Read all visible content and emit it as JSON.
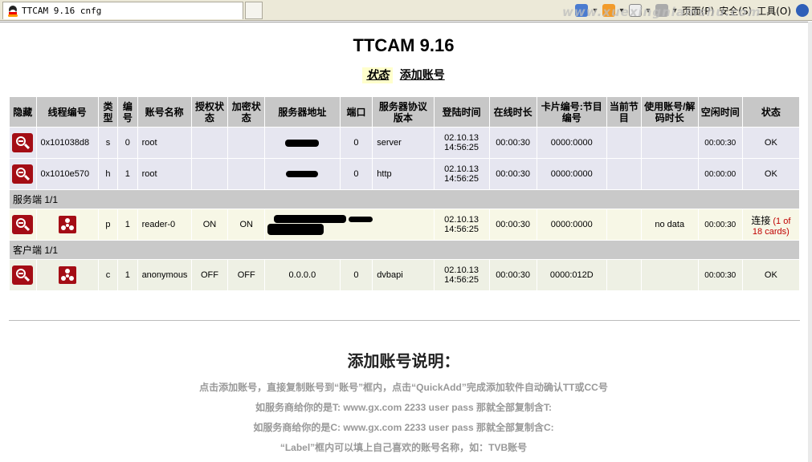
{
  "browser": {
    "tab_title": "TTCAM 9.16 cnfg",
    "menu_page": "页面(P)",
    "menu_safety": "安全(S)",
    "menu_tools": "工具(O)",
    "arrow": "▾",
    "watermark": "www.xuexingniamshu.com"
  },
  "page": {
    "title": "TTCAM 9.16",
    "nav_status": "状态",
    "nav_add": "添加账号"
  },
  "table": {
    "headers": [
      "隐藏",
      "线程编号",
      "类型",
      "编号",
      "账号名称",
      "授权状态",
      "加密状态",
      "服务器地址",
      "端口",
      "服务器协议版本",
      "登陆时间",
      "在线时长",
      "卡片编号:节目编号",
      "当前节目",
      "使用账号/解码时长",
      "空闲时间",
      "状态"
    ],
    "rows": [
      {
        "thread": "0x101038d8",
        "type": "s",
        "num": "0",
        "name": "root",
        "auth": "",
        "crypt": "",
        "port": "0",
        "proto": "server",
        "login_date": "02.10.13",
        "login_time": "14:56:25",
        "online": "00:00:30",
        "card": "0000:0000",
        "current": "",
        "usage": "",
        "idle": "00:00:30",
        "status": "OK"
      },
      {
        "thread": "0x1010e570",
        "type": "h",
        "num": "1",
        "name": "root",
        "auth": "",
        "crypt": "",
        "port": "0",
        "proto": "http",
        "login_date": "02.10.13",
        "login_time": "14:56:25",
        "online": "00:00:30",
        "card": "0000:0000",
        "current": "",
        "usage": "",
        "idle": "00:00:00",
        "status": "OK"
      }
    ],
    "section_server": "服务端 1/1",
    "server_row": {
      "type": "p",
      "num": "1",
      "name": "reader-0",
      "auth": "ON",
      "crypt": "ON",
      "port": "",
      "proto": "",
      "login_date": "02.10.13",
      "login_time": "14:56:25",
      "online": "00:00:30",
      "card": "0000:0000",
      "current": "",
      "usage": "no data",
      "idle": "00:00:30",
      "status": "连接",
      "status_note_1": "(1 of",
      "status_note_2": "18 cards)"
    },
    "section_client": "客户端 1/1",
    "client_row": {
      "type": "c",
      "num": "1",
      "name": "anonymous",
      "auth": "OFF",
      "crypt": "OFF",
      "server": "0.0.0.0",
      "port": "0",
      "proto": "dvbapi",
      "login_date": "02.10.13",
      "login_time": "14:56:25",
      "online": "00:00:30",
      "card": "0000:012D",
      "current": "",
      "usage": "",
      "idle": "00:00:30",
      "status": "OK"
    }
  },
  "help": {
    "title": "添加账号说明：",
    "line1": "点击添加账号，直接复制账号到“账号”框内，点击“QuickAdd”完成添加软件自动确认TT或CC号",
    "line2": "如服务商给你的是T: www.gx.com 2233 user pass 那就全部复制含T:",
    "line3": "如服务商给你的是C: www.gx.com 2233 user pass 那就全部复制含C:",
    "line4": "“Label”框内可以填上自己喜欢的账号名称，如：TVB账号"
  }
}
